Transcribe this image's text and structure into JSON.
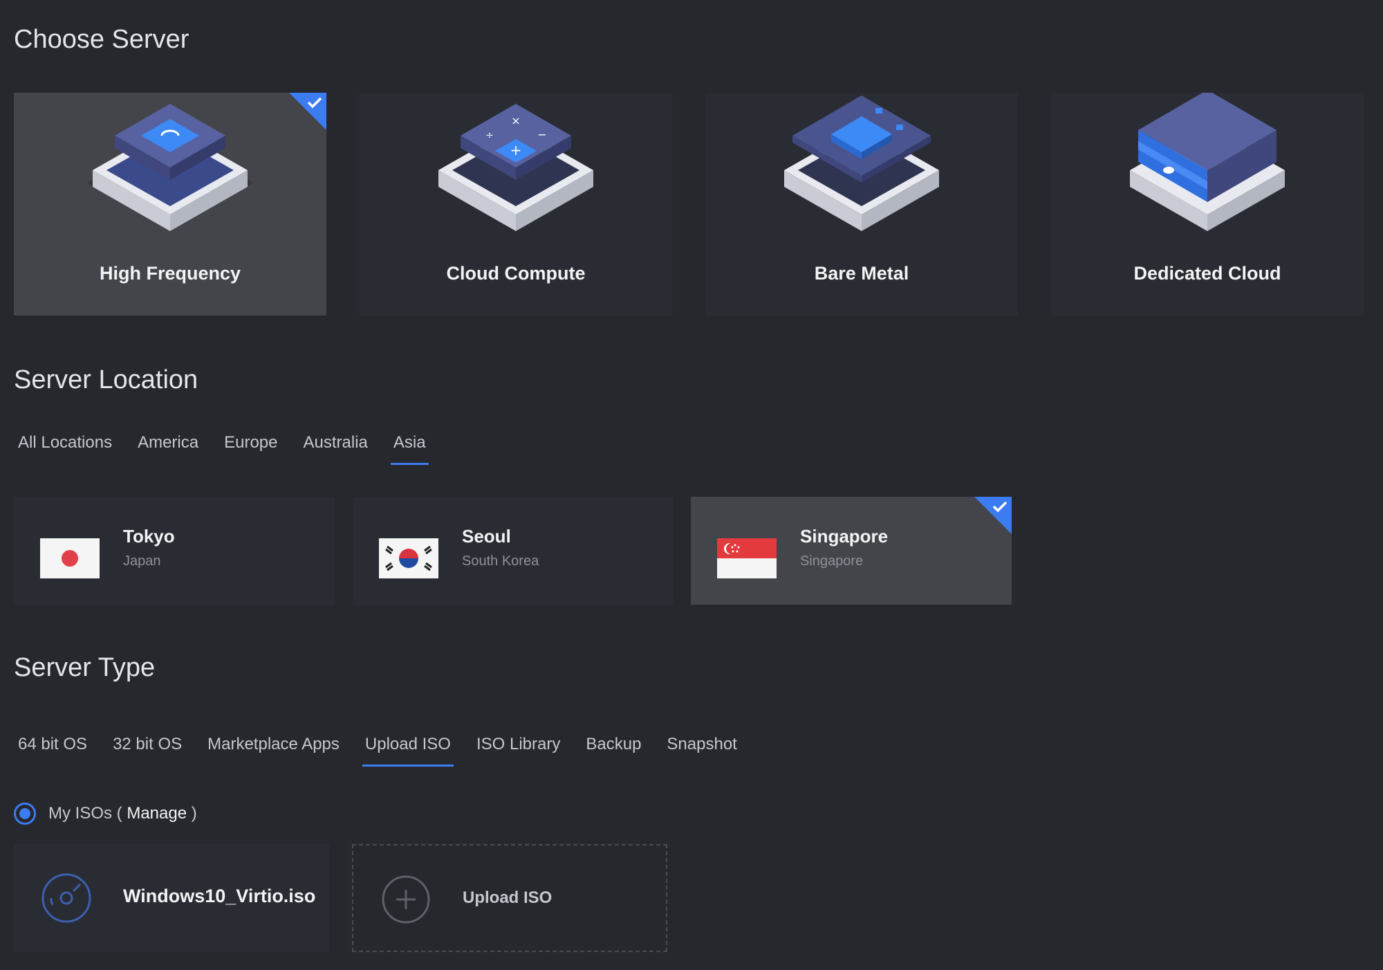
{
  "choose_server": {
    "title": "Choose Server",
    "cards": [
      {
        "label": "High Frequency",
        "selected": true
      },
      {
        "label": "Cloud Compute",
        "selected": false
      },
      {
        "label": "Bare Metal",
        "selected": false
      },
      {
        "label": "Dedicated Cloud",
        "selected": false
      }
    ]
  },
  "server_location": {
    "title": "Server Location",
    "tabs": [
      "All Locations",
      "America",
      "Europe",
      "Australia",
      "Asia"
    ],
    "active_tab": "Asia",
    "locations": [
      {
        "city": "Tokyo",
        "country": "Japan",
        "flag": "japan-flag-icon",
        "selected": false
      },
      {
        "city": "Seoul",
        "country": "South Korea",
        "flag": "south-korea-flag-icon",
        "selected": false
      },
      {
        "city": "Singapore",
        "country": "Singapore",
        "flag": "singapore-flag-icon",
        "selected": true
      }
    ]
  },
  "server_type": {
    "title": "Server Type",
    "tabs": [
      "64 bit OS",
      "32 bit OS",
      "Marketplace Apps",
      "Upload ISO",
      "ISO Library",
      "Backup",
      "Snapshot"
    ],
    "active_tab": "Upload ISO",
    "radio": {
      "label_prefix": "My ISOs ( ",
      "manage": "Manage",
      "label_suffix": " )"
    },
    "isos": [
      {
        "name": "Windows10_Virtio.iso",
        "icon": "disc-icon"
      },
      {
        "name": "Upload ISO",
        "icon": "plus-circle-icon"
      }
    ]
  },
  "colors": {
    "background": "#26282e",
    "card": "#2a2c33",
    "card_selected": "#44454b",
    "accent": "#3c7bf0"
  }
}
